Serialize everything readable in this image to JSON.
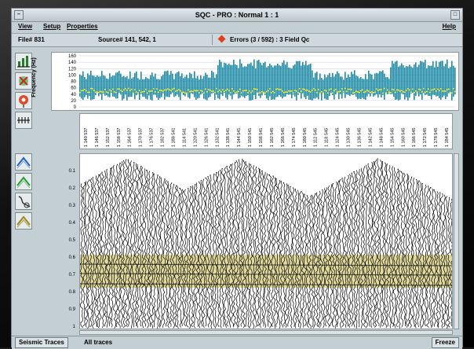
{
  "window": {
    "title": "SQC - PRO : Normal 1 : 1"
  },
  "menu": {
    "items": [
      "View",
      "Setup",
      "Properties"
    ],
    "help": "Help"
  },
  "info": {
    "file": "File# 831",
    "source": "Source# 141, 542, 1",
    "errors": "Errors (3 / 592) : 3 Field Qc"
  },
  "frequency_panel": {
    "ylabel": "Frequency (Hz)",
    "ticks": [
      "160",
      "140",
      "120",
      "100",
      "80",
      "60",
      "40",
      "20",
      "0"
    ],
    "colors": {
      "bar": "#1e8aa6",
      "dominant": "#f2e600"
    }
  },
  "trace_headers": [
    "1 140 537",
    "1 146 537",
    "1 152 537",
    "1 158 537",
    "1 164 537",
    "1 170 537",
    "1 176 537",
    "1 182 537",
    "1 188 541",
    "1 114 541",
    "1 120 541",
    "1 126 541",
    "1 132 541",
    "1 138 541",
    "1 144 541",
    "1 150 541",
    "1 156 541",
    "1 162 545",
    "1 168 545",
    "1 174 545",
    "1 180 545",
    "1 112 545",
    "1 118 545",
    "1 124 545",
    "1 130 545",
    "1 136 545",
    "1 142 545",
    "1 148 545",
    "1 154 545",
    "1 160 545",
    "1 166 545",
    "1 172 545",
    "1 178 545",
    "1 184 545"
  ],
  "time_axis": [
    "0.1",
    "0.2",
    "0.3",
    "0.4",
    "0.5",
    "0.6",
    "0.7",
    "0.8",
    "0.9",
    "1"
  ],
  "seismic": {
    "highlight_color": "#d9cf86"
  },
  "status": {
    "view_button": "Seismic Traces",
    "filter": "All traces",
    "freeze_button": "Freeze"
  },
  "title_buttons": {
    "left": "–",
    "right": "□"
  }
}
